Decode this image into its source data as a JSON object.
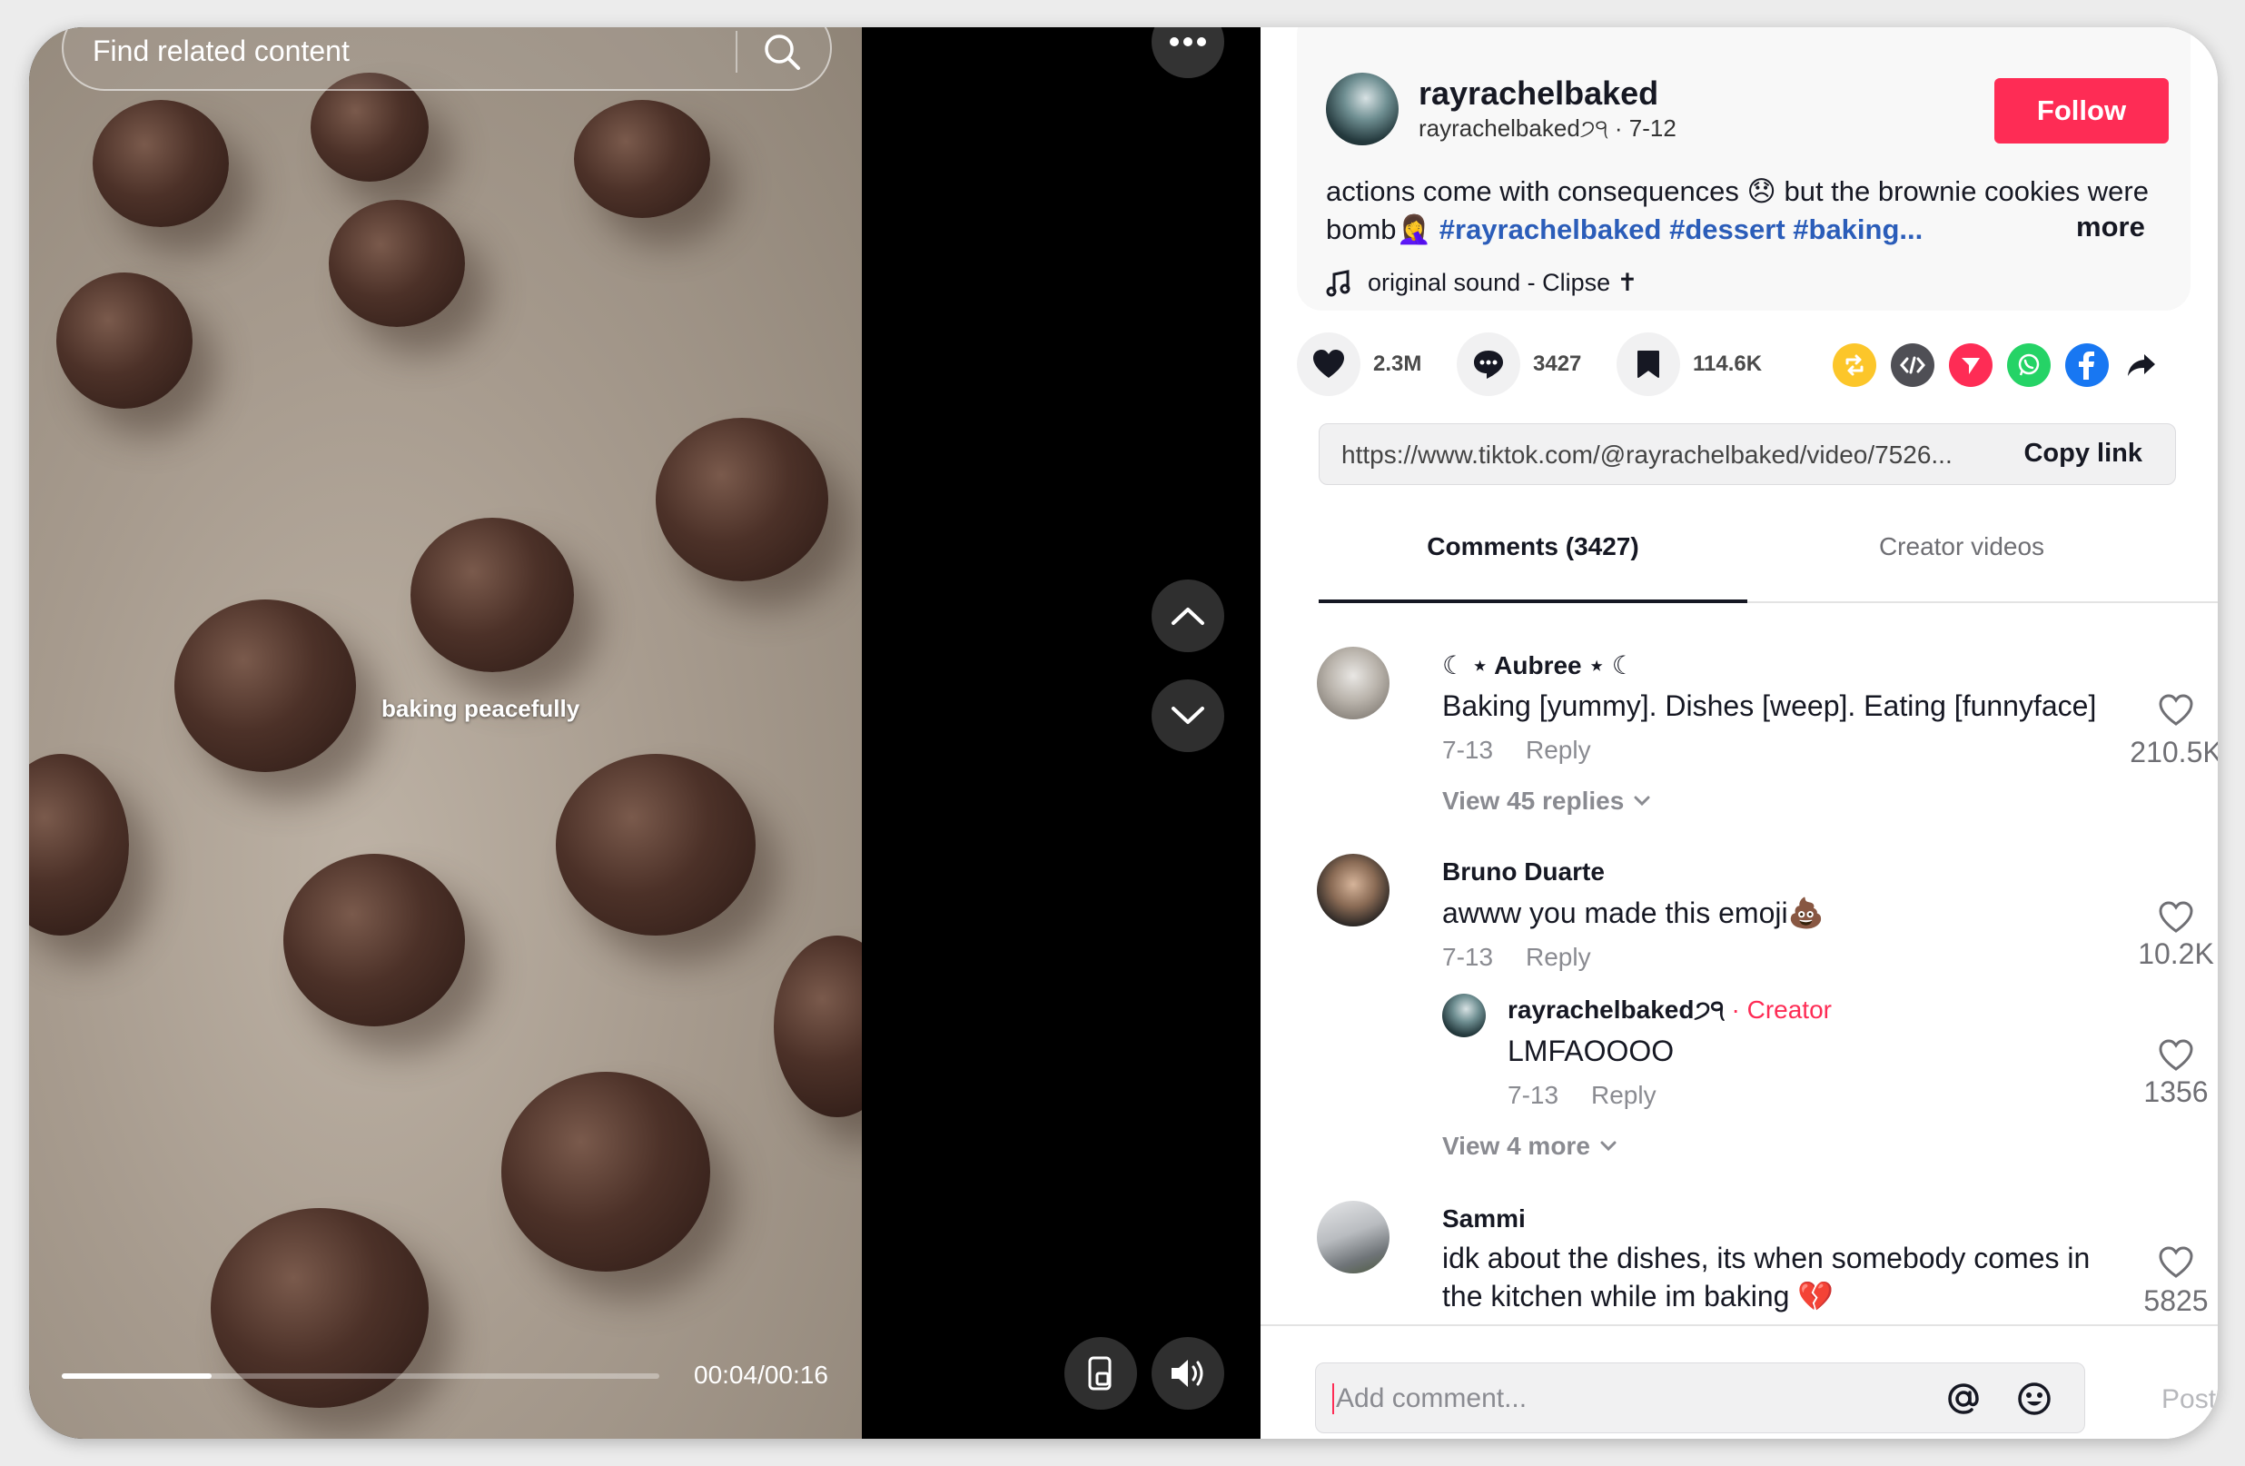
{
  "search": {
    "placeholder": "Find related content"
  },
  "video": {
    "overlay_text": "baking peacefully",
    "time": "00:04/00:16",
    "progress": 0.25
  },
  "post": {
    "username": "rayrachelbaked",
    "handle_line": "rayrachelbaked੭੧ · 7-12",
    "follow_label": "Follow",
    "caption_text": "actions come with consequences 😞 but the brownie cookies were bomb🤦‍♀️ ",
    "hashtags": [
      "#rayrachelbaked",
      "#dessert",
      "#baking..."
    ],
    "more_label": "more",
    "sound": "original sound - Clipse ✝"
  },
  "actions": {
    "likes": "2.3M",
    "comments": "3427",
    "saves": "114.6K"
  },
  "share_icons": [
    "repost-icon",
    "embed-icon",
    "send-icon",
    "whatsapp-icon",
    "facebook-icon",
    "share-arrow-icon"
  ],
  "colors": {
    "accent": "#fe2c55",
    "hashtag": "#2b5db9",
    "repost": "#fcc62a",
    "embed": "#4f4f55",
    "send": "#fe2c55",
    "whatsapp": "#25d366",
    "facebook": "#1877f2"
  },
  "link": {
    "url": "https://www.tiktok.com/@rayrachelbaked/video/7526...",
    "copy_label": "Copy link"
  },
  "tabs": {
    "comments": "Comments (3427)",
    "creator": "Creator videos"
  },
  "comments": [
    {
      "name": "☾ ⋆ Aubree ⋆ ☾",
      "text": "Baking [yummy]. Dishes [weep]. Eating [funnyface]",
      "date": "7-13",
      "reply": "Reply",
      "likes": "210.5K",
      "view_replies": "View 45 replies"
    },
    {
      "name": "Bruno Duarte",
      "text": "awww you made this emoji💩",
      "date": "7-13",
      "reply": "Reply",
      "likes": "10.2K",
      "sub": {
        "name": "rayrachelbaked੭੧",
        "tag": " · Creator",
        "text": "LMFAOOOO",
        "date": "7-13",
        "reply": "Reply",
        "likes": "1356"
      },
      "view_more": "View 4 more"
    },
    {
      "name": "Sammi",
      "text_line1": "idk about the dishes, its when somebody comes in",
      "text_line2": "the kitchen while im baking 💔",
      "likes": "5825"
    }
  ],
  "comment_box": {
    "placeholder": "Add comment...",
    "post_label": "Post"
  }
}
